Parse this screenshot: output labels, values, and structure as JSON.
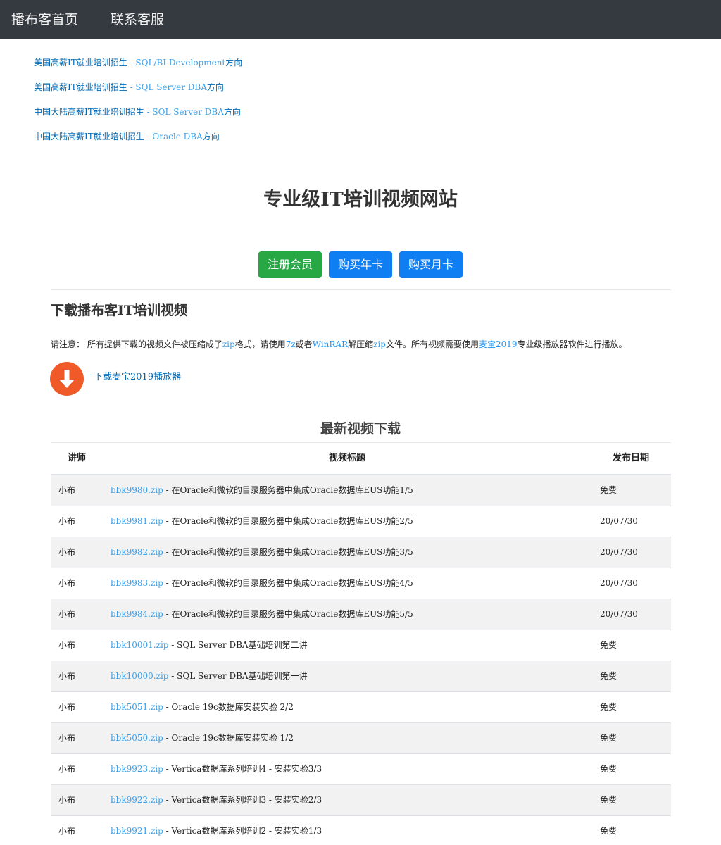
{
  "nav": {
    "home": "播布客首页",
    "contact": "联系客服"
  },
  "promos": [
    {
      "cn": "美国高薪IT就业培训招生",
      "en": " - SQL/BI Development",
      "tail": "方向"
    },
    {
      "cn": "美国高薪IT就业培训招生",
      "en": " - SQL Server DBA",
      "tail": "方向"
    },
    {
      "cn": "中国大陆高薪IT就业培训招生",
      "en": " - SQL Server DBA",
      "tail": "方向"
    },
    {
      "cn": "中国大陆高薪IT就业培训招生",
      "en": " - Oracle DBA",
      "tail": "方向"
    }
  ],
  "hero": {
    "title": "专业级IT培训视频网站"
  },
  "buttons": {
    "register": "注册会员",
    "buy_year": "购买年卡",
    "buy_month": "购买月卡"
  },
  "section": {
    "title": "下载播布客IT培训视频"
  },
  "notice": {
    "p1": "请注意：  所有提供下载的视频文件被压缩成了",
    "zip1": "zip",
    "p2": "格式，请使用",
    "link_7z": "7z",
    "p3": "或者",
    "link_winrar": "WinRAR",
    "p4": "解压缩",
    "zip2": "zip",
    "p5": "文件。所有视频需要使用",
    "link_player": "麦宝2019",
    "p6": "专业级播放器软件进行播放。"
  },
  "download": {
    "label": "下载麦宝2019播放器",
    "icon": "download-arrow-icon",
    "color": "#f05a28"
  },
  "list": {
    "title": "最新视频下载",
    "headers": {
      "lecturer": "讲师",
      "title": "视频标题",
      "date": "发布日期"
    },
    "rows": [
      {
        "lecturer": "小布",
        "file": "bbk9980.zip",
        "title": " - 在Oracle和微软的目录服务器中集成Oracle数据库EUS功能1/5",
        "date": "免费"
      },
      {
        "lecturer": "小布",
        "file": "bbk9981.zip",
        "title": " - 在Oracle和微软的目录服务器中集成Oracle数据库EUS功能2/5",
        "date": "20/07/30"
      },
      {
        "lecturer": "小布",
        "file": "bbk9982.zip",
        "title": " - 在Oracle和微软的目录服务器中集成Oracle数据库EUS功能3/5",
        "date": "20/07/30"
      },
      {
        "lecturer": "小布",
        "file": "bbk9983.zip",
        "title": " - 在Oracle和微软的目录服务器中集成Oracle数据库EUS功能4/5",
        "date": "20/07/30"
      },
      {
        "lecturer": "小布",
        "file": "bbk9984.zip",
        "title": " - 在Oracle和微软的目录服务器中集成Oracle数据库EUS功能5/5",
        "date": "20/07/30"
      },
      {
        "lecturer": "小布",
        "file": "bbk10001.zip",
        "title": " - SQL Server DBA基础培训第二讲",
        "date": "免费"
      },
      {
        "lecturer": "小布",
        "file": "bbk10000.zip",
        "title": " - SQL Server DBA基础培训第一讲",
        "date": "免费"
      },
      {
        "lecturer": "小布",
        "file": "bbk5051.zip",
        "title": " - Oracle 19c数据库安装实验 2/2",
        "date": "免费"
      },
      {
        "lecturer": "小布",
        "file": "bbk5050.zip",
        "title": " - Oracle 19c数据库安装实验 1/2",
        "date": "免费"
      },
      {
        "lecturer": "小布",
        "file": "bbk9923.zip",
        "title": " - Vertica数据库系列培训4 - 安装实验3/3",
        "date": "免费"
      },
      {
        "lecturer": "小布",
        "file": "bbk9922.zip",
        "title": " - Vertica数据库系列培训3 - 安装实验2/3",
        "date": "免费"
      },
      {
        "lecturer": "小布",
        "file": "bbk9921.zip",
        "title": " - Vertica数据库系列培训2 - 安装实验1/3",
        "date": "免费"
      }
    ]
  }
}
